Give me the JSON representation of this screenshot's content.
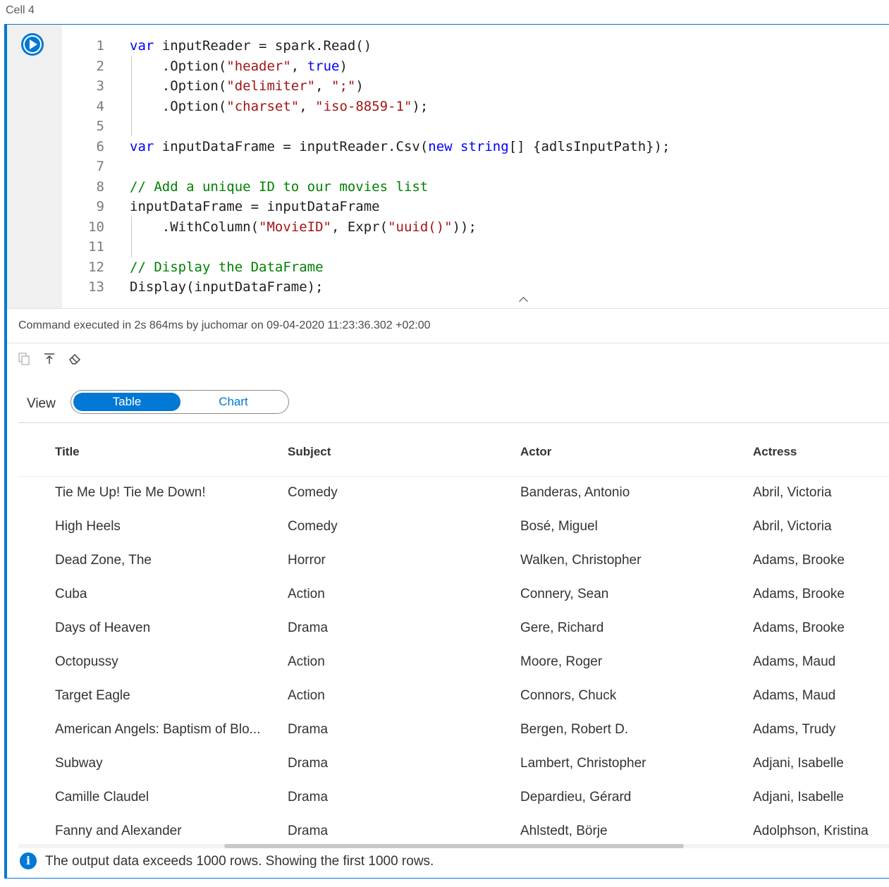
{
  "cell": {
    "label": "Cell 4"
  },
  "code_lines": [
    {
      "num": "1",
      "tokens": [
        {
          "t": "var",
          "c": "kw"
        },
        {
          "t": " inputReader = spark.Read()",
          "c": ""
        }
      ]
    },
    {
      "num": "2",
      "tokens": [
        {
          "t": "    .Option(",
          "c": ""
        },
        {
          "t": "\"header\"",
          "c": "str"
        },
        {
          "t": ", ",
          "c": ""
        },
        {
          "t": "true",
          "c": "kw"
        },
        {
          "t": ")",
          "c": ""
        }
      ]
    },
    {
      "num": "3",
      "tokens": [
        {
          "t": "    .Option(",
          "c": ""
        },
        {
          "t": "\"delimiter\"",
          "c": "str"
        },
        {
          "t": ", ",
          "c": ""
        },
        {
          "t": "\";\"",
          "c": "str"
        },
        {
          "t": ")",
          "c": ""
        }
      ]
    },
    {
      "num": "4",
      "tokens": [
        {
          "t": "    .Option(",
          "c": ""
        },
        {
          "t": "\"charset\"",
          "c": "str"
        },
        {
          "t": ", ",
          "c": ""
        },
        {
          "t": "\"iso-8859-1\"",
          "c": "str"
        },
        {
          "t": ");",
          "c": ""
        }
      ]
    },
    {
      "num": "5",
      "tokens": []
    },
    {
      "num": "6",
      "tokens": [
        {
          "t": "var",
          "c": "kw"
        },
        {
          "t": " inputDataFrame = inputReader.Csv(",
          "c": ""
        },
        {
          "t": "new",
          "c": "kw"
        },
        {
          "t": " ",
          "c": ""
        },
        {
          "t": "string",
          "c": "kw"
        },
        {
          "t": "[] {adlsInputPath});",
          "c": ""
        }
      ]
    },
    {
      "num": "7",
      "tokens": []
    },
    {
      "num": "8",
      "tokens": [
        {
          "t": "// Add a unique ID to our movies list",
          "c": "cmt"
        }
      ]
    },
    {
      "num": "9",
      "tokens": [
        {
          "t": "inputDataFrame = inputDataFrame",
          "c": ""
        }
      ]
    },
    {
      "num": "10",
      "tokens": [
        {
          "t": "    .WithColumn(",
          "c": ""
        },
        {
          "t": "\"MovieID\"",
          "c": "str"
        },
        {
          "t": ", Expr(",
          "c": ""
        },
        {
          "t": "\"uuid()\"",
          "c": "str"
        },
        {
          "t": "));",
          "c": ""
        }
      ]
    },
    {
      "num": "11",
      "tokens": []
    },
    {
      "num": "12",
      "tokens": [
        {
          "t": "// Display the DataFrame",
          "c": "cmt"
        }
      ]
    },
    {
      "num": "13",
      "tokens": [
        {
          "t": "Display(inputDataFrame);",
          "c": ""
        }
      ]
    }
  ],
  "execution": {
    "status": "Command executed in 2s 864ms by juchomar on 09-04-2020 11:23:36.302 +02:00"
  },
  "toolbar": {
    "icons": [
      "copy-icon",
      "export-icon",
      "eraser-icon"
    ]
  },
  "view": {
    "label": "View",
    "options": [
      "Table",
      "Chart"
    ],
    "selected": "Table"
  },
  "table": {
    "columns": [
      "Title",
      "Subject",
      "Actor",
      "Actress"
    ],
    "rows": [
      [
        "Tie Me Up! Tie Me Down!",
        "Comedy",
        "Banderas, Antonio",
        "Abril, Victoria"
      ],
      [
        "High Heels",
        "Comedy",
        "Bosé, Miguel",
        "Abril, Victoria"
      ],
      [
        "Dead Zone, The",
        "Horror",
        "Walken, Christopher",
        "Adams, Brooke"
      ],
      [
        "Cuba",
        "Action",
        "Connery, Sean",
        "Adams, Brooke"
      ],
      [
        "Days of Heaven",
        "Drama",
        "Gere, Richard",
        "Adams, Brooke"
      ],
      [
        "Octopussy",
        "Action",
        "Moore, Roger",
        "Adams, Maud"
      ],
      [
        "Target Eagle",
        "Action",
        "Connors, Chuck",
        "Adams, Maud"
      ],
      [
        "American Angels: Baptism of Blo...",
        "Drama",
        "Bergen, Robert D.",
        "Adams, Trudy"
      ],
      [
        "Subway",
        "Drama",
        "Lambert, Christopher",
        "Adjani, Isabelle"
      ],
      [
        "Camille Claudel",
        "Drama",
        "Depardieu, Gérard",
        "Adjani, Isabelle"
      ],
      [
        "Fanny and Alexander",
        "Drama",
        "Ahlstedt, Börje",
        "Adolphson, Kristina"
      ]
    ]
  },
  "info": {
    "icon": "info-icon",
    "message": "The output data exceeds 1000 rows. Showing the first 1000 rows."
  },
  "colors": {
    "accent": "#0078d4",
    "keyword": "#0000ff",
    "string": "#a31515",
    "comment": "#008000"
  }
}
